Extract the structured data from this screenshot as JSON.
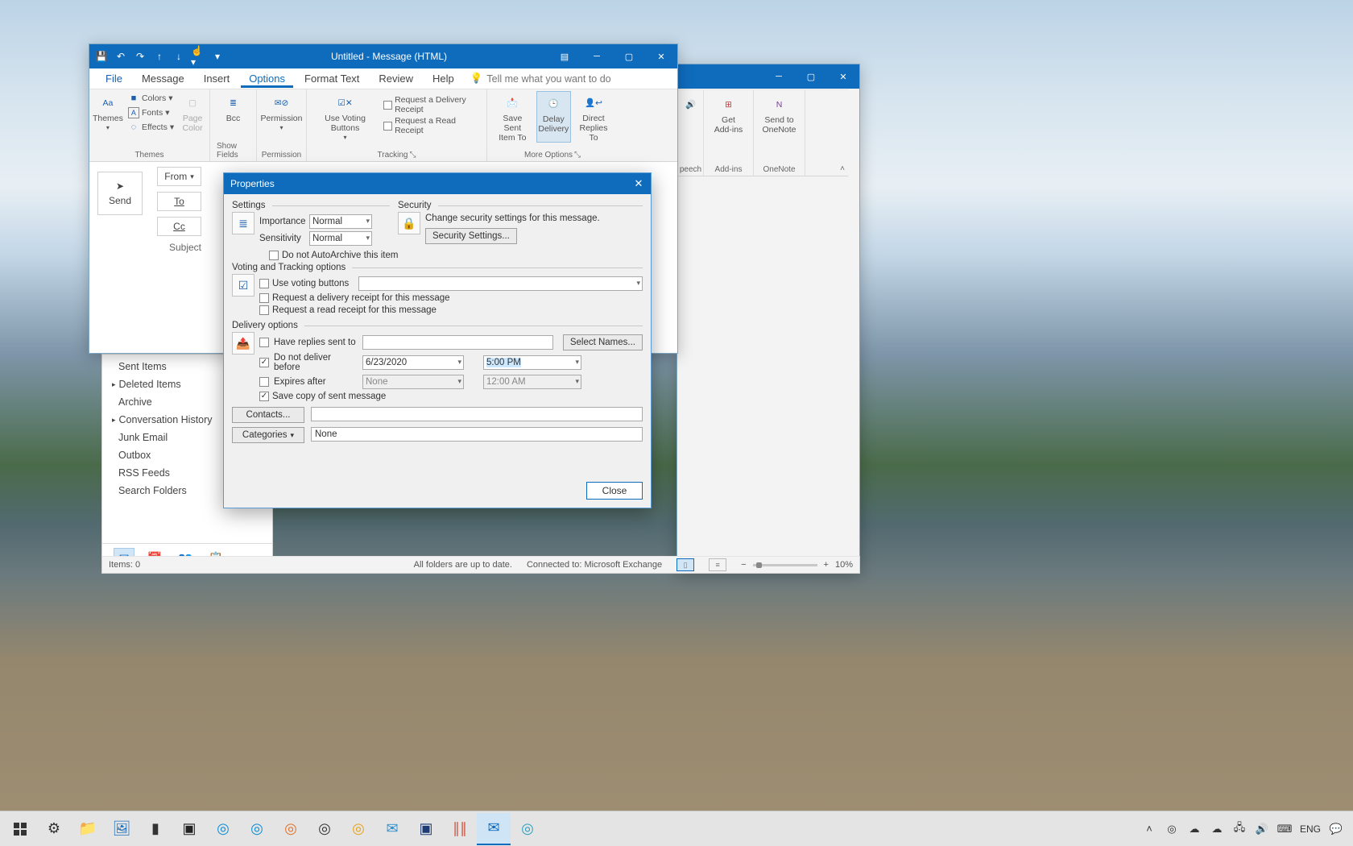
{
  "message_window": {
    "title": "Untitled  -  Message (HTML)",
    "menu": {
      "file": "File",
      "message": "Message",
      "insert": "Insert",
      "options": "Options",
      "format_text": "Format Text",
      "review": "Review",
      "help": "Help",
      "tellme": "Tell me what you want to do"
    },
    "ribbon": {
      "themes_btn": "Themes",
      "colors": "Colors",
      "fonts": "Fonts",
      "effects": "Effects",
      "page_color": "Page Color",
      "themes_group": "Themes",
      "bcc": "Bcc",
      "show_fields_group": "Show Fields",
      "permission": "Permission",
      "permission_group": "Permission",
      "voting": "Use Voting Buttons",
      "delivery_receipt": "Request a Delivery Receipt",
      "read_receipt": "Request a Read Receipt",
      "tracking_group": "Tracking",
      "save_sent": "Save Sent Item To",
      "delay": "Delay Delivery",
      "direct": "Direct Replies To",
      "more_options_group": "More Options"
    },
    "compose": {
      "send": "Send",
      "from": "From",
      "to": "To",
      "cc": "Cc",
      "subject": "Subject"
    }
  },
  "outlook_extra": {
    "speech": "peech",
    "get_addins": "Get Add-ins",
    "send_onenote": "Send to OneNote",
    "addins_group": "Add-ins",
    "onenote_group": "OneNote"
  },
  "properties": {
    "title": "Properties",
    "settings_title": "Settings",
    "security_title": "Security",
    "importance_label": "Importance",
    "importance_value": "Normal",
    "sensitivity_label": "Sensitivity",
    "sensitivity_value": "Normal",
    "autoarchive": "Do not AutoArchive this item",
    "sec_text": "Change security settings for this message.",
    "sec_btn": "Security Settings...",
    "voting_title": "Voting and Tracking options",
    "use_voting": "Use voting buttons",
    "delivery_receipt": "Request a delivery receipt for this message",
    "read_receipt": "Request a read receipt for this message",
    "delivery_title": "Delivery options",
    "replies_to": "Have replies sent to",
    "select_names": "Select Names...",
    "no_deliver": "Do not deliver before",
    "no_deliver_date": "6/23/2020",
    "no_deliver_time": "5:00 PM",
    "expires": "Expires after",
    "expires_date": "None",
    "expires_time": "12:00 AM",
    "save_copy": "Save copy of sent message",
    "contacts": "Contacts...",
    "categories": "Categories",
    "categories_value": "None",
    "close": "Close"
  },
  "folders": {
    "sent": "Sent Items",
    "deleted": "Deleted Items",
    "archive": "Archive",
    "conv": "Conversation History",
    "junk": "Junk Email",
    "outbox": "Outbox",
    "rss": "RSS Feeds",
    "search": "Search Folders"
  },
  "statusbar": {
    "items": "Items: 0",
    "uptodate": "All folders are up to date.",
    "connected": "Connected to: Microsoft Exchange",
    "zoom": "10%"
  },
  "taskbar": {
    "lang": "ENG"
  }
}
